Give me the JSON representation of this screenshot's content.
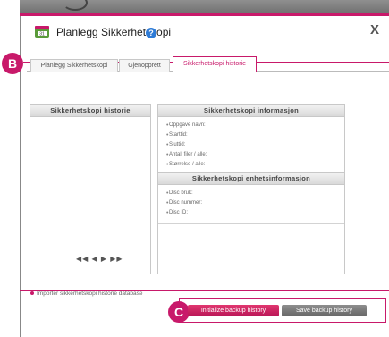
{
  "dialog": {
    "title": "Planlegg Sikkerhetskopi",
    "help_glyph": "?",
    "close_label": "X",
    "tabs": [
      {
        "label": "Planlegg Sikkerhetskopi",
        "selected": false
      },
      {
        "label": "Gjenopprett",
        "selected": false
      },
      {
        "label": "Sikkerhetskopi historie",
        "selected": true
      }
    ],
    "history_panel": {
      "header": "Sikkerhetskopi historie",
      "pager": "◀◀ ◀ ▶ ▶▶"
    },
    "info_panel": {
      "header": "Sikkerhetskopi informasjon",
      "fields": [
        "Oppgave navn:",
        "Starttid:",
        "Sluttid:",
        "Antall filer / alle:",
        "Størrelse / alle:"
      ]
    },
    "device_panel": {
      "header": "Sikkerhetskopi enhetsinformasjon",
      "fields": [
        "Disc bruk:",
        "Disc nummer:",
        "Disc ID:"
      ]
    },
    "import_link": "Importer sikkerhetskopi historie database",
    "buttons": {
      "initialize": "Initialize backup history",
      "save": "Save backup history"
    }
  },
  "callouts": {
    "b": "B",
    "c": "C"
  },
  "colors": {
    "accent": "#c8196a",
    "header_bg": "#e3e3e3",
    "button_gray": "#777777"
  },
  "icons": [
    "calendar-icon",
    "help-icon",
    "close-icon",
    "bullet-icon",
    "pager-arrows-icon"
  ]
}
